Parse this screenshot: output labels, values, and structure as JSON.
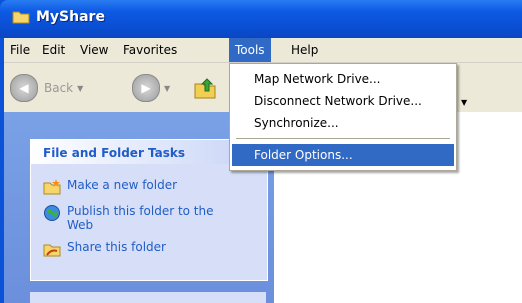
{
  "window": {
    "title": "MyShare",
    "title_icon": "folder-icon"
  },
  "menubar": {
    "items": [
      {
        "label": "File"
      },
      {
        "label": "Edit"
      },
      {
        "label": "View"
      },
      {
        "label": "Favorites"
      },
      {
        "label": "Tools",
        "active": true
      },
      {
        "label": "Help"
      }
    ]
  },
  "toolbar": {
    "back_label": "Back"
  },
  "tools_menu": {
    "items": [
      {
        "label": "Map Network Drive..."
      },
      {
        "label": "Disconnect Network Drive..."
      },
      {
        "label": "Synchronize..."
      },
      {
        "label": "Folder Options...",
        "highlighted": true
      }
    ]
  },
  "task_pane": {
    "title": "File and Folder Tasks",
    "tasks": [
      {
        "label": "Make a new folder",
        "icon": "new-folder-icon"
      },
      {
        "label": "Publish this folder to the Web",
        "icon": "globe-icon"
      },
      {
        "label": "Share this folder",
        "icon": "share-folder-icon"
      }
    ]
  },
  "colors": {
    "titlebar": "#0a53d9",
    "menu_highlight": "#316ac5",
    "task_link": "#215dc6"
  }
}
